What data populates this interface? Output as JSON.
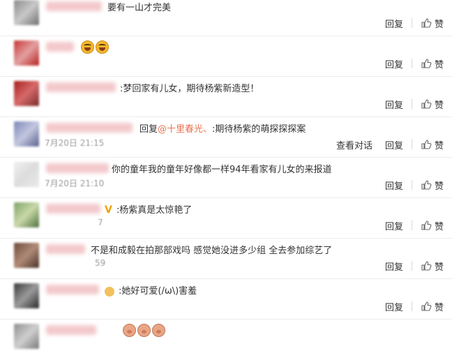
{
  "actions": {
    "reply": "回复",
    "like": "赞",
    "view_conversation": "查看对话"
  },
  "comments": [
    {
      "text": "要有一山才完美"
    },
    {
      "text": ""
    },
    {
      "prefix": ":",
      "text": "梦回家有儿女，期待杨紫新造型！"
    },
    {
      "reply_prefix": "回复",
      "mention": "@十里春光、",
      "text": ":期待杨紫的萌探探探案",
      "time_snippet": "7月20日 21:15"
    },
    {
      "text": "你的童年我的童年好像都一样94年看家有儿女的来报道",
      "time_snippet": "7月20日 21:10"
    },
    {
      "badge": "V",
      "prefix": ":",
      "text": "杨紫真是太惊艳了",
      "time_snippet": "7"
    },
    {
      "text": "不是和成毅在拍那部戏吗 感觉她没进多少组 全去参加综艺了",
      "time_snippet": "59"
    },
    {
      "prefix": ":",
      "text": "她好可爱(/ω\\)害羞"
    },
    {
      "text": ""
    }
  ],
  "colors": {
    "mention": "#eb7350",
    "divider": "#ececec",
    "username_blur": "#f3c9cc"
  }
}
